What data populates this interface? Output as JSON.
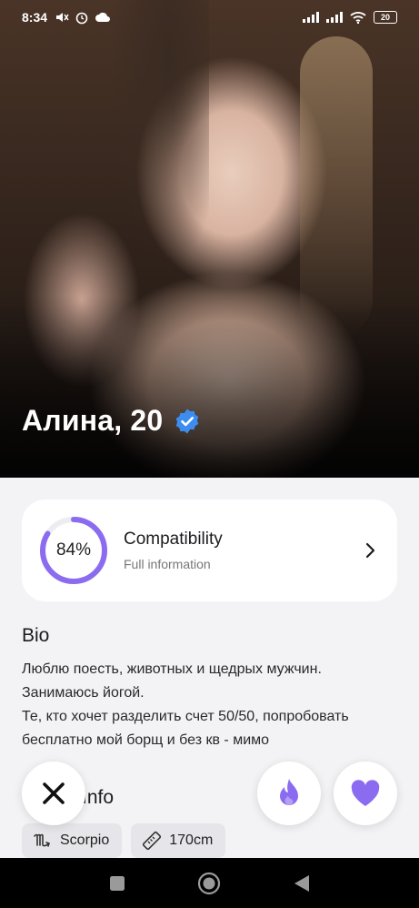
{
  "status_bar": {
    "time": "8:34",
    "battery": "20",
    "left_icons": [
      "mute-icon",
      "alarm-icon",
      "weather-icon"
    ],
    "right_icons": [
      "signal-icon",
      "signal-icon",
      "wifi-icon",
      "battery-icon"
    ]
  },
  "profile": {
    "name_age": "Алина, 20",
    "verified": true,
    "accent_color": "#8b6cf0"
  },
  "compatibility": {
    "percent_label": "84%",
    "percent_value": 84,
    "title": "Compatibility",
    "subtitle": "Full information"
  },
  "bio": {
    "title": "Bio",
    "text": "Люблю поесть, животных и щедрых мужчин.\nЗанимаюсь йогой.\nТе, кто хочет разделить счет 50/50, попробовать бесплатно мой борщ и без кв - мимо"
  },
  "info": {
    "title": "Info",
    "chips": [
      {
        "icon": "scorpio-icon",
        "label": "Scorpio"
      },
      {
        "icon": "ruler-icon",
        "label": "170cm"
      }
    ]
  },
  "actions": {
    "dislike_icon": "close-icon",
    "superlike_icon": "fire-icon",
    "like_icon": "heart-icon"
  },
  "nav_bar": [
    "recents-icon",
    "home-icon",
    "back-icon"
  ]
}
